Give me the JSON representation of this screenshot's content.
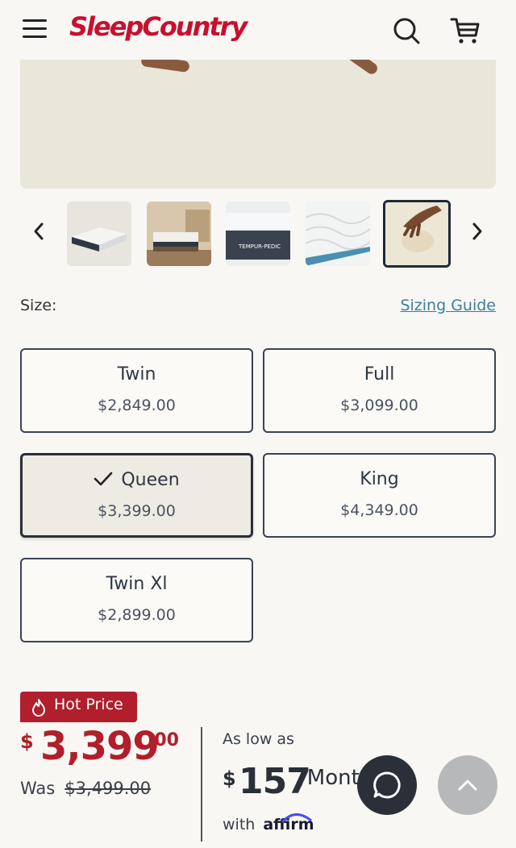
{
  "header": {
    "logo_text": "SleepCountry",
    "brand_color": "#c8102e",
    "icons": [
      "menu-icon",
      "search-icon",
      "cart-icon"
    ]
  },
  "carousel": {
    "thumbnails": [
      {
        "name": "mattress-angle"
      },
      {
        "name": "mattress-in-bedroom"
      },
      {
        "name": "tempur-pedic-label",
        "text": "TEMPUR-PEDIC"
      },
      {
        "name": "mattress-surface-detail"
      },
      {
        "name": "hand-pressing-mattress",
        "selected": true
      }
    ]
  },
  "size": {
    "label": "Size:",
    "guide_link": "Sizing Guide",
    "options": [
      {
        "name": "Twin",
        "price": "$2,849.00",
        "selected": false
      },
      {
        "name": "Full",
        "price": "$3,099.00",
        "selected": false
      },
      {
        "name": "Queen",
        "price": "$3,399.00",
        "selected": true
      },
      {
        "name": "King",
        "price": "$4,349.00",
        "selected": false
      },
      {
        "name": "Twin Xl",
        "price": "$2,899.00",
        "selected": false
      }
    ]
  },
  "pricing": {
    "badge": "Hot Price",
    "currency": "$",
    "price_whole": "3,399",
    "price_cents": ".00",
    "was_label": "Was",
    "was_price": "$3,499.00",
    "accent_color": "#b01f2b",
    "financing_label": "As low as",
    "monthly_currency": "$",
    "monthly_amount": "157",
    "monthly_suffix": "/Mont",
    "with_label": "with",
    "affirm_text": "affirm"
  },
  "floating": {
    "chat_icon": "chat-bubble-icon",
    "top_icon": "chevron-up-icon"
  }
}
